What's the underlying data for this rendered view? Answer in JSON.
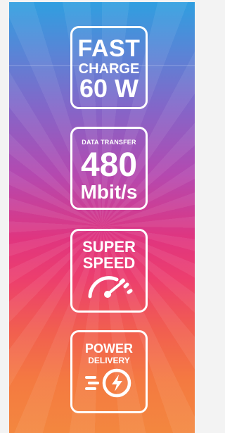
{
  "badges": {
    "fast_charge": {
      "line1": "FAST",
      "line2": "CHARGE",
      "line3": "60 W"
    },
    "data_transfer": {
      "line1": "DATA TRANSFER",
      "line2": "480",
      "line3": "Mbit/s"
    },
    "super_speed": {
      "line1": "SUPER",
      "line2": "SPEED",
      "icon": "speedometer-icon"
    },
    "power_delivery": {
      "line1": "POWER",
      "line2": "DELIVERY",
      "icon": "fast-charge-bolt-icon"
    }
  },
  "colors": {
    "gradient_top": "#2f9fe0",
    "gradient_middle": "#e0357f",
    "gradient_bottom": "#f3873f",
    "badge_stroke": "#ffffff",
    "page_background": "#f3f3f3"
  }
}
